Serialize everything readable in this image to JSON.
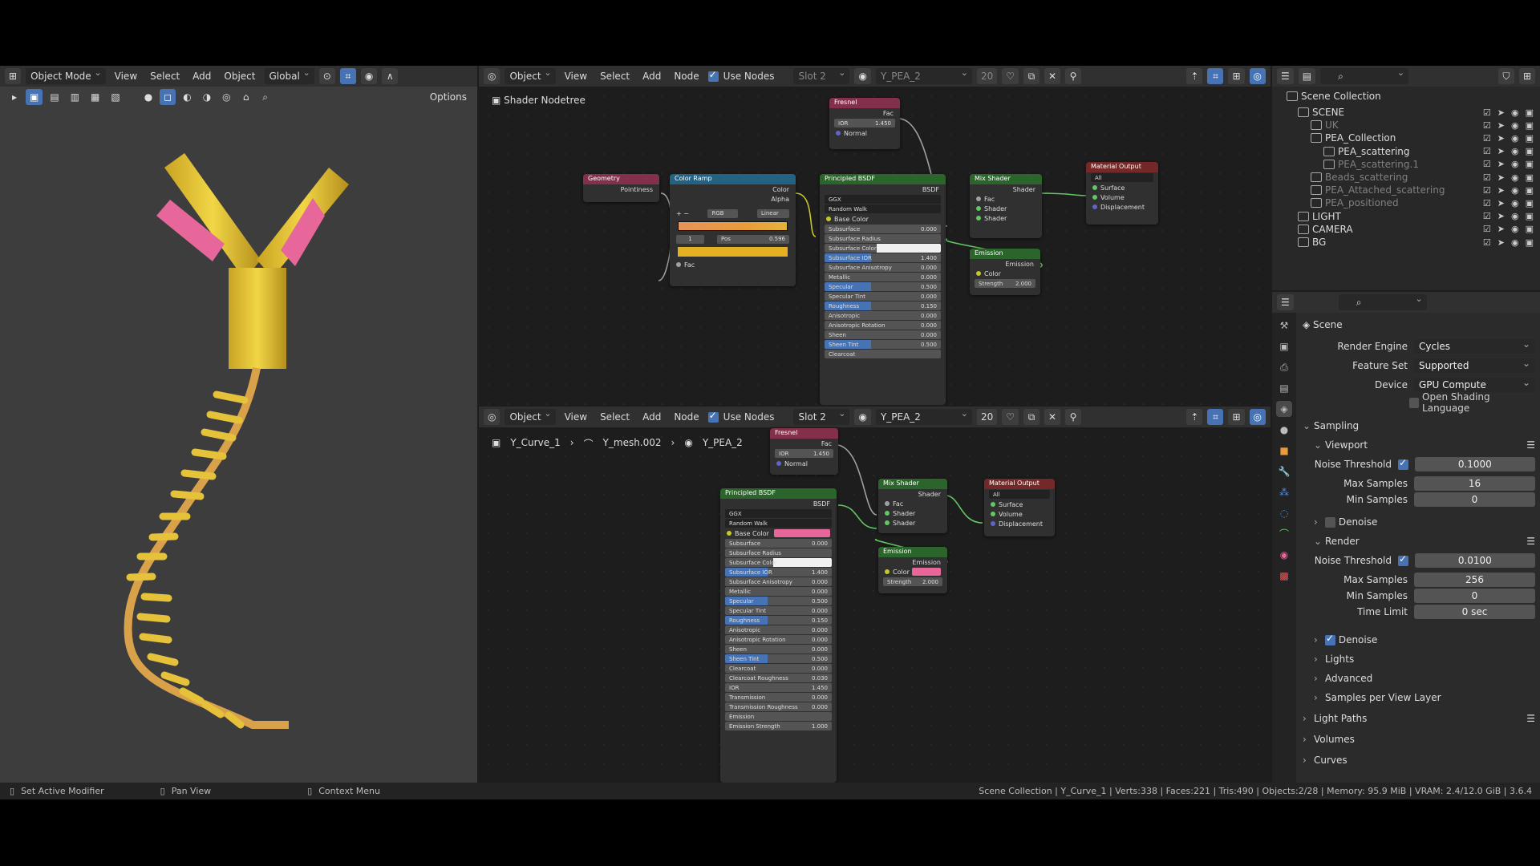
{
  "viewport": {
    "mode": "Object Mode",
    "menus": [
      "View",
      "Select",
      "Add",
      "Object"
    ],
    "transform": "Global",
    "options": "Options"
  },
  "node_top": {
    "object": "Object",
    "menus": [
      "View",
      "Select",
      "Add",
      "Node"
    ],
    "use_nodes": "Use Nodes",
    "slot": "Slot 2",
    "material": "Y_PEA_2",
    "users": "20",
    "breadcrumb": "Shader Nodetree",
    "nodes": {
      "fresnel": {
        "title": "Fresnel",
        "out": "Fac",
        "ior_label": "IOR",
        "ior": "1.450",
        "normal": "Normal"
      },
      "geometry": {
        "title": "Geometry",
        "out": "Pointiness"
      },
      "ramp": {
        "title": "Color Ramp",
        "out1": "Color",
        "out2": "Alpha",
        "mode": "RGB",
        "interp": "Linear",
        "idx": "1",
        "pos_label": "Pos",
        "pos": "0.596",
        "in": "Fac"
      },
      "bsdf": {
        "title": "Principled BSDF",
        "out": "BSDF",
        "dist": "GGX",
        "sss": "Random Walk",
        "base": "Base Color",
        "fields": [
          {
            "label": "Subsurface",
            "value": "0.000"
          },
          {
            "label": "Subsurface Radius",
            "value": ""
          },
          {
            "label": "Subsurface Color",
            "value": ""
          },
          {
            "label": "Subsurface IOR",
            "value": "1.400"
          },
          {
            "label": "Subsurface Anisotropy",
            "value": "0.000"
          },
          {
            "label": "Metallic",
            "value": "0.000"
          },
          {
            "label": "Specular",
            "value": "0.500"
          },
          {
            "label": "Specular Tint",
            "value": "0.000"
          },
          {
            "label": "Roughness",
            "value": "0.150"
          },
          {
            "label": "Anisotropic",
            "value": "0.000"
          },
          {
            "label": "Anisotropic Rotation",
            "value": "0.000"
          },
          {
            "label": "Sheen",
            "value": "0.000"
          },
          {
            "label": "Sheen Tint",
            "value": "0.500"
          },
          {
            "label": "Clearcoat",
            "value": ""
          }
        ]
      },
      "mix": {
        "title": "Mix Shader",
        "out": "Shader",
        "fac": "Fac",
        "s1": "Shader",
        "s2": "Shader"
      },
      "emission": {
        "title": "Emission",
        "out": "Emission",
        "color": "Color",
        "strength_label": "Strength",
        "strength": "2.000"
      },
      "output": {
        "title": "Material Output",
        "target": "All",
        "surface": "Surface",
        "volume": "Volume",
        "displacement": "Displacement"
      }
    }
  },
  "node_bottom": {
    "object": "Object",
    "menus": [
      "View",
      "Select",
      "Add",
      "Node"
    ],
    "use_nodes": "Use Nodes",
    "slot": "Slot 2",
    "material": "Y_PEA_2",
    "users": "20",
    "breadcrumb": [
      "Y_Curve_1",
      "Y_mesh.002",
      "Y_PEA_2"
    ],
    "nodes": {
      "fresnel": {
        "title": "Fresnel",
        "out": "Fac",
        "ior_label": "IOR",
        "ior": "1.450",
        "normal": "Normal"
      },
      "bsdf": {
        "title": "Principled BSDF",
        "out": "BSDF",
        "dist": "GGX",
        "sss": "Random Walk",
        "base": "Base Color",
        "fields": [
          {
            "label": "Subsurface",
            "value": "0.000"
          },
          {
            "label": "Subsurface Radius",
            "value": ""
          },
          {
            "label": "Subsurface Color",
            "value": ""
          },
          {
            "label": "Subsurface IOR",
            "value": "1.400"
          },
          {
            "label": "Subsurface Anisotropy",
            "value": "0.000"
          },
          {
            "label": "Metallic",
            "value": "0.000"
          },
          {
            "label": "Specular",
            "value": "0.500"
          },
          {
            "label": "Specular Tint",
            "value": "0.000"
          },
          {
            "label": "Roughness",
            "value": "0.150"
          },
          {
            "label": "Anisotropic",
            "value": "0.000"
          },
          {
            "label": "Anisotropic Rotation",
            "value": "0.000"
          },
          {
            "label": "Sheen",
            "value": "0.000"
          },
          {
            "label": "Sheen Tint",
            "value": "0.500"
          },
          {
            "label": "Clearcoat",
            "value": "0.000"
          },
          {
            "label": "Clearcoat Roughness",
            "value": "0.030"
          },
          {
            "label": "IOR",
            "value": "1.450"
          },
          {
            "label": "Transmission",
            "value": "0.000"
          },
          {
            "label": "Transmission Roughness",
            "value": "0.000"
          },
          {
            "label": "Emission",
            "value": ""
          },
          {
            "label": "Emission Strength",
            "value": "1.000"
          }
        ]
      },
      "mix": {
        "title": "Mix Shader",
        "out": "Shader",
        "fac": "Fac",
        "s1": "Shader",
        "s2": "Shader"
      },
      "emission": {
        "title": "Emission",
        "out": "Emission",
        "color": "Color",
        "strength_label": "Strength",
        "strength": "2.000"
      },
      "output": {
        "title": "Material Output",
        "target": "All",
        "surface": "Surface",
        "volume": "Volume",
        "displacement": "Displacement"
      }
    }
  },
  "outliner": {
    "root": "Scene Collection",
    "rows": [
      {
        "name": "SCENE",
        "dim": false
      },
      {
        "name": "UK",
        "dim": true
      },
      {
        "name": "PEA_Collection",
        "dim": false
      },
      {
        "name": "PEA_scattering",
        "dim": false
      },
      {
        "name": "PEA_scattering.1",
        "dim": true
      },
      {
        "name": "Beads_scattering",
        "dim": true
      },
      {
        "name": "PEA_Attached_scattering",
        "dim": true
      },
      {
        "name": "PEA_positioned",
        "dim": true
      },
      {
        "name": "LIGHT",
        "dim": false
      },
      {
        "name": "CAMERA",
        "dim": false
      },
      {
        "name": "BG",
        "dim": false
      }
    ]
  },
  "properties": {
    "context": "Scene",
    "render_engine_label": "Render Engine",
    "render_engine": "Cycles",
    "feature_set_label": "Feature Set",
    "feature_set": "Supported",
    "device_label": "Device",
    "device": "GPU Compute",
    "osl": "Open Shading Language",
    "sampling": "Sampling",
    "viewport": "Viewport",
    "vp_noise_label": "Noise Threshold",
    "vp_noise": "0.1000",
    "vp_max_label": "Max Samples",
    "vp_max": "16",
    "vp_min_label": "Min Samples",
    "vp_min": "0",
    "denoise": "Denoise",
    "render": "Render",
    "r_noise_label": "Noise Threshold",
    "r_noise": "0.0100",
    "r_max_label": "Max Samples",
    "r_max": "256",
    "r_min_label": "Min Samples",
    "r_min": "0",
    "r_time_label": "Time Limit",
    "r_time": "0 sec",
    "r_denoise": "Denoise",
    "lights": "Lights",
    "advanced": "Advanced",
    "samples_layer": "Samples per View Layer",
    "light_paths": "Light Paths",
    "volumes": "Volumes",
    "curves": "Curves"
  },
  "status": {
    "left1": "Set Active Modifier",
    "left2": "Pan View",
    "left3": "Context Menu",
    "right": "Scene Collection | Y_Curve_1 | Verts:338 | Faces:221 | Tris:490 | Objects:2/28 | Memory: 95.9 MiB | VRAM: 2.4/12.0 GiB | 3.6.4"
  },
  "colors": {
    "yellow": "#e5c23a",
    "pink": "#e8679a",
    "orange": "#e89b3a",
    "accent": "#4772b3"
  }
}
